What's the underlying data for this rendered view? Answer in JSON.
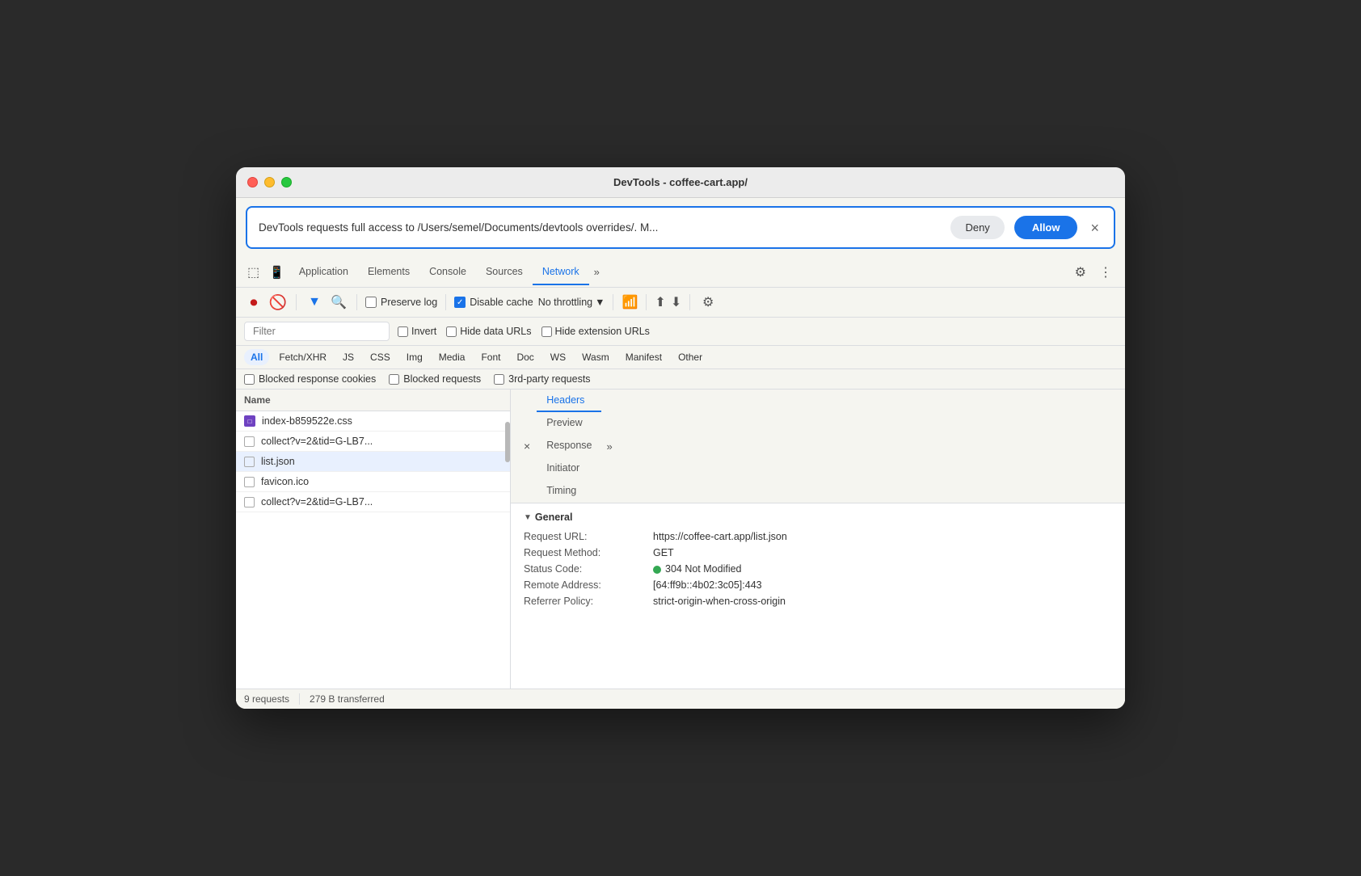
{
  "window": {
    "title": "DevTools - coffee-cart.app/"
  },
  "permission_banner": {
    "text": "DevTools requests full access to /Users/semel/Documents/devtools overrides/. M...",
    "deny_label": "Deny",
    "allow_label": "Allow"
  },
  "tabs": {
    "items": [
      {
        "label": "Application",
        "active": false
      },
      {
        "label": "Elements",
        "active": false
      },
      {
        "label": "Console",
        "active": false
      },
      {
        "label": "Sources",
        "active": false
      },
      {
        "label": "Network",
        "active": true
      }
    ],
    "more_label": "»"
  },
  "toolbar": {
    "preserve_log": "Preserve log",
    "disable_cache": "Disable cache",
    "throttle": "No throttling"
  },
  "filter": {
    "placeholder": "Filter",
    "invert": "Invert",
    "hide_data_urls": "Hide data URLs",
    "hide_extension_urls": "Hide extension URLs"
  },
  "type_filters": [
    {
      "label": "All",
      "active": true
    },
    {
      "label": "Fetch/XHR",
      "active": false
    },
    {
      "label": "JS",
      "active": false
    },
    {
      "label": "CSS",
      "active": false
    },
    {
      "label": "Img",
      "active": false
    },
    {
      "label": "Media",
      "active": false
    },
    {
      "label": "Font",
      "active": false
    },
    {
      "label": "Doc",
      "active": false
    },
    {
      "label": "WS",
      "active": false
    },
    {
      "label": "Wasm",
      "active": false
    },
    {
      "label": "Manifest",
      "active": false
    },
    {
      "label": "Other",
      "active": false
    }
  ],
  "blocked": {
    "response_cookies": "Blocked response cookies",
    "blocked_requests": "Blocked requests",
    "third_party": "3rd-party requests"
  },
  "file_list": {
    "column_name": "Name",
    "items": [
      {
        "name": "index-b859522e.css",
        "type": "css",
        "selected": false
      },
      {
        "name": "collect?v=2&tid=G-LB7...",
        "type": "file",
        "selected": false
      },
      {
        "name": "list.json",
        "type": "file",
        "selected": true
      },
      {
        "name": "favicon.ico",
        "type": "file",
        "selected": false
      },
      {
        "name": "collect?v=2&tid=G-LB7...",
        "type": "file",
        "selected": false
      }
    ]
  },
  "details": {
    "close_icon": "×",
    "tabs": [
      {
        "label": "Headers",
        "active": true
      },
      {
        "label": "Preview",
        "active": false
      },
      {
        "label": "Response",
        "active": false
      },
      {
        "label": "Initiator",
        "active": false
      },
      {
        "label": "Timing",
        "active": false
      }
    ],
    "more_label": "»",
    "general_section": {
      "title": "General",
      "rows": [
        {
          "label": "Request URL:",
          "value": "https://coffee-cart.app/list.json"
        },
        {
          "label": "Request Method:",
          "value": "GET"
        },
        {
          "label": "Status Code:",
          "value": "304 Not Modified",
          "has_status_dot": true
        },
        {
          "label": "Remote Address:",
          "value": "[64:ff9b::4b02:3c05]:443"
        },
        {
          "label": "Referrer Policy:",
          "value": "strict-origin-when-cross-origin"
        }
      ]
    }
  },
  "status_bar": {
    "requests": "9 requests",
    "transferred": "279 B transferred"
  }
}
